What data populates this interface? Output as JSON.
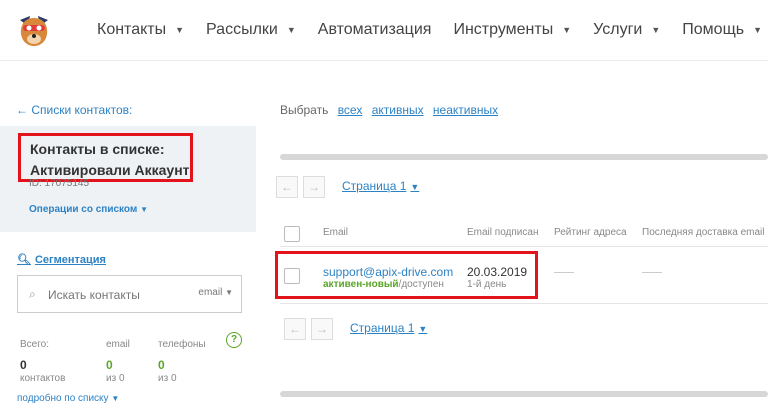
{
  "nav": {
    "logo": "mascot-logo",
    "items": [
      {
        "label": "Контакты",
        "dropdown": true
      },
      {
        "label": "Рассылки",
        "dropdown": true
      },
      {
        "label": "Автоматизация",
        "dropdown": false
      },
      {
        "label": "Инструменты",
        "dropdown": true
      },
      {
        "label": "Услуги",
        "dropdown": true
      },
      {
        "label": "Помощь",
        "dropdown": true
      }
    ]
  },
  "sidebar": {
    "back_link": "← Списки контактов:",
    "list_title_line1": "Контакты в списке:",
    "list_title_line2": "Активировали Аккаунт",
    "list_id": "ID: 17075145",
    "list_ops": "Операции со списком",
    "segmentation": "Сегментация",
    "search_placeholder": "Искать контакты",
    "search_filter": "email",
    "stats": {
      "total_label": "Всего:",
      "email_label": "email",
      "phones_label": "телефоны",
      "total_value": "0",
      "total_sub": "контактов",
      "email_value": "0",
      "email_sub": "из 0",
      "phones_value": "0",
      "phones_sub": "из 0"
    },
    "more": "подробно по списку"
  },
  "main": {
    "select_label": "Выбрать",
    "select_all": "всех",
    "select_active": "активных",
    "select_inactive": "неактивных",
    "pager_label": "Страница 1",
    "columns": [
      "Email",
      "Email подписан",
      "Рейтинг адреса",
      "Последняя доставка email"
    ],
    "rows": [
      {
        "email": "support@apix-drive.com",
        "status_ok": "активен-новый",
        "status_rest": "/доступен",
        "date": "20.03.2019",
        "days": "1-й день"
      }
    ]
  },
  "colors": {
    "link": "#2d82c4",
    "highlight": "#e3131b",
    "ok": "#5aa52a",
    "card": "#eef2f5"
  }
}
